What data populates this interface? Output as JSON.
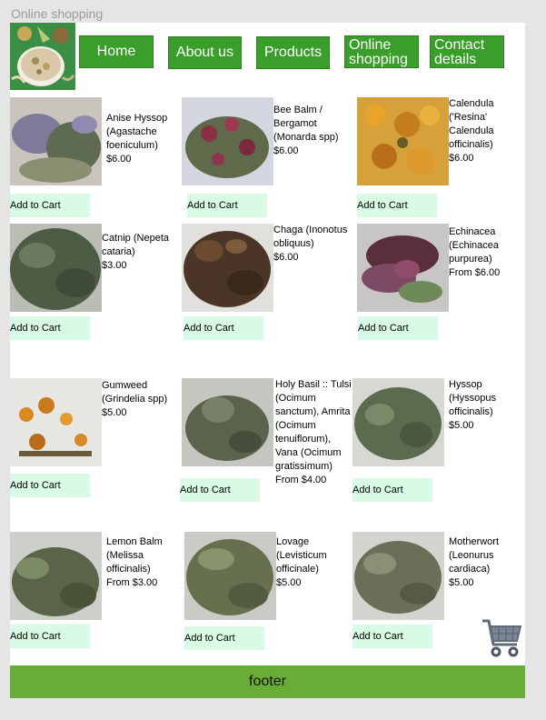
{
  "page_title": "Online shopping",
  "nav": {
    "home": "Home",
    "about": "About us",
    "products": "Products",
    "online_shopping": "Online shopping",
    "contact": "Contact details"
  },
  "add_to_cart_label": "Add to Cart",
  "products": [
    {
      "name": "Anise Hyssop (Agastache foeniculum)",
      "price": "$6.00"
    },
    {
      "name": "Bee Balm / Bergamot (Monarda spp)",
      "price": "$6.00"
    },
    {
      "name": "Calendula ('Resina' Calendula officinalis)",
      "price": "$6.00"
    },
    {
      "name": "Catnip (Nepeta cataria)",
      "price": "$3.00"
    },
    {
      "name": "Chaga (Inonotus obliquus)",
      "price": "$6.00"
    },
    {
      "name": "Echinacea (Echinacea purpurea)",
      "price": "From $6.00"
    },
    {
      "name": "Gumweed (Grindelia spp)",
      "price": "$5.00"
    },
    {
      "name": "Holy Basil :: Tulsi (Ocimum sanctum), Amrita (Ocimum tenuiflorum), Vana (Ocimum gratissimum)",
      "price": "From $4.00"
    },
    {
      "name": "Hyssop (Hyssopus officinalis)",
      "price": "$5.00"
    },
    {
      "name": "Lemon Balm (Melissa officinalis)",
      "price": "From $3.00"
    },
    {
      "name": "Lovage (Levisticum officinale)",
      "price": "$5.00"
    },
    {
      "name": "Motherwort (Leonurus cardiaca)",
      "price": "$5.00"
    }
  ],
  "footer": "footer",
  "colors": {
    "nav_bg": "#3a9e2a",
    "cart_button_bg": "#d9fbe6",
    "footer_bg": "#6aad36"
  },
  "icons": [
    "herbs-logo",
    "shopping-cart-icon"
  ]
}
